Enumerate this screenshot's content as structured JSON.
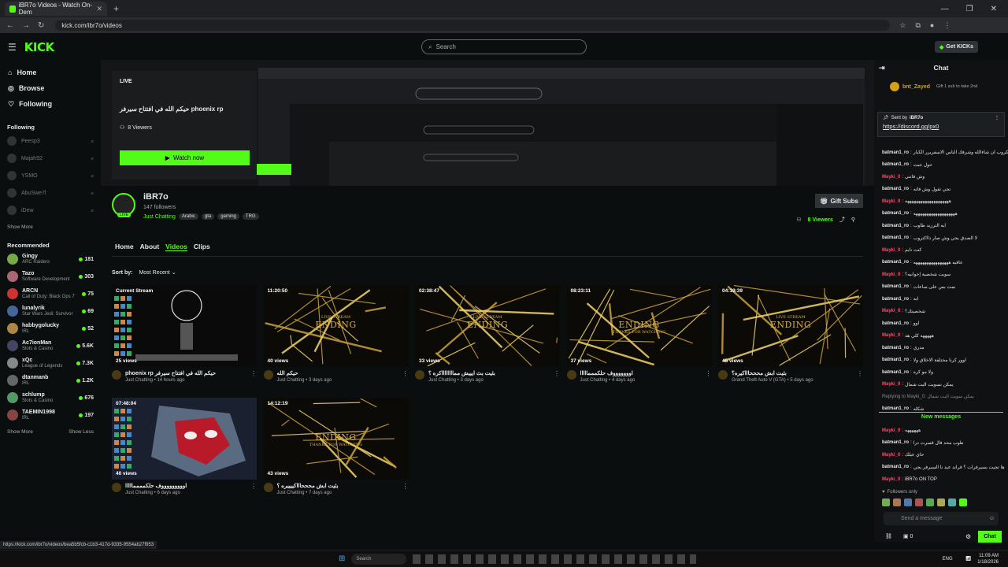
{
  "browser": {
    "tab_title": "iBR7o Videos - Watch On-Dem",
    "url": "kick.com/ibr7o/videos",
    "status_url": "https://kick.com/ibr7o/videos/bea5b5fcb-c1b3-417d-9335-9554ab27f953"
  },
  "header": {
    "logo": "KICK",
    "search_placeholder": "Search",
    "get_kicks": "Get KICKs"
  },
  "sidebar": {
    "nav": [
      {
        "label": "Home",
        "icon": "home-icon"
      },
      {
        "label": "Browse",
        "icon": "compass-icon"
      },
      {
        "label": "Following",
        "icon": "heart-icon"
      }
    ],
    "following_title": "Following",
    "following": [
      "Peesp3",
      "Majah92",
      "YSMO",
      "AbuSwe7l",
      "iDew"
    ],
    "show_more": "Show More",
    "show_less": "Show Less",
    "recommended_title": "Recommended",
    "recommended": [
      {
        "name": "Gingy",
        "cat": "ARC Raiders",
        "viewers": "181"
      },
      {
        "name": "Tazo",
        "cat": "Software Development",
        "viewers": "303"
      },
      {
        "name": "ARCN",
        "cat": "Call of Duty: Black Ops 7",
        "viewers": "75"
      },
      {
        "name": "lunalyrik",
        "cat": "Star Wars Jedi: Survivor",
        "viewers": "69"
      },
      {
        "name": "habbygolucky",
        "cat": "IRL",
        "viewers": "52"
      },
      {
        "name": "Ac7ionMan",
        "cat": "Slots & Casino",
        "viewers": "5.6K"
      },
      {
        "name": "xQc",
        "cat": "League of Legends",
        "viewers": "7.3K"
      },
      {
        "name": "dtanmanb",
        "cat": "IRL",
        "viewers": "1.2K"
      },
      {
        "name": "schlump",
        "cat": "Slots & Casino",
        "viewers": "676"
      },
      {
        "name": "TAEMIN1998",
        "cat": "IRL",
        "viewers": "197"
      }
    ]
  },
  "livecard": {
    "badge": "LIVE",
    "title": "phoenix rp حيكم الله في افتتاح سيرفر",
    "viewers": "8 Viewers",
    "watch": "Watch now"
  },
  "channel": {
    "name": "iBR7o",
    "followers": "147 followers",
    "category": "Just Chatting",
    "tags": [
      "Arabic",
      "gta",
      "gaming",
      "TRG"
    ],
    "gift_subs": "Gift Subs",
    "viewers": "8 Viewers",
    "live_badge": "LIVE"
  },
  "tabs": [
    "Home",
    "About",
    "Videos",
    "Clips"
  ],
  "sort": {
    "label": "Sort by:",
    "value": "Most Recent"
  },
  "videos": [
    {
      "dur": "Current Stream",
      "views": "25 views",
      "title": "phoenix rp حيكم الله في افتتاح سيرفر",
      "sub": "Just Chatting • 14 hours ago",
      "thumb": "stream"
    },
    {
      "dur": "11:20:50",
      "views": "40 views",
      "title": "حيكم الله",
      "sub": "Just Chatting • 3 days ago",
      "thumb": "ending"
    },
    {
      "dur": "02:38:47",
      "views": "33 views",
      "title": "بثيت بث ايييش ممااااااااكره ؟",
      "sub": "Just Chatting • 3 days ago",
      "thumb": "ending"
    },
    {
      "dur": "08:23:11",
      "views": "37 views",
      "title": "اوووووووف حلكمممااااا",
      "sub": "Just Chatting • 4 days ago",
      "thumb": "ending2"
    },
    {
      "dur": "04:19:39",
      "views": "45 views",
      "title": "بثيت ابش محححاااكيره؟",
      "sub": "Grand Theft Auto V (GTA) • 5 days ago",
      "thumb": "ending"
    },
    {
      "dur": "07:48:04",
      "views": "40 views",
      "title": "اوووووووووف حلكممممااااا",
      "sub": "Just Chatting • 6 days ago",
      "thumb": "spider"
    },
    {
      "dur": "14:12:19",
      "views": "43 views",
      "title": "بثيت ابش محححاااكييييره ؟",
      "sub": "Just Chatting • 7 days ago",
      "thumb": "ending2"
    }
  ],
  "ending": {
    "main": "ENDING",
    "live": "LIVE STREAM",
    "thanks": "THANKS FOR WATCHING"
  },
  "chat": {
    "title": "Chat",
    "top_gifter": "bnt_Zayed",
    "gift_text": "Gift 1 sub to take 2nd",
    "pinned_by": "Sent by",
    "pinned_user": "iBR7o",
    "pinned_link": "https://discord.gg/px0",
    "messages": [
      {
        "u": "batman1_ro",
        "t": "الكروب ان شاءالله وشرفك الناس الاسفريرر الكبار",
        "c": "u1"
      },
      {
        "u": "batman1_ro",
        "t": "حول جبت",
        "c": "u1"
      },
      {
        "u": "Mayki_0",
        "t": "وش فاتني",
        "c": "u2"
      },
      {
        "u": "batman1_ro",
        "t": "تجي تقول وش فاته",
        "c": "u1"
      },
      {
        "u": "Mayki_0",
        "t": "ههههههههههههههههههههه",
        "c": "u2"
      },
      {
        "u": "batman1_ro",
        "t": "هههههههههههههههههههه",
        "c": "u1"
      },
      {
        "u": "batman1_ro",
        "t": "ايه الترزيد طاوب",
        "c": "u1"
      },
      {
        "u": "batman1_ro",
        "t": "لا الصدق يجي وش صار ذااكتروب",
        "c": "u1"
      },
      {
        "u": "Mayki_0",
        "t": "كنت نايم",
        "c": "u2"
      },
      {
        "u": "batman1_ro",
        "t": "عافيه ههههههههههههههههه",
        "c": "u1"
      },
      {
        "u": "Mayki_0",
        "t": "سويت شخصية إخوانيه؟",
        "c": "u2"
      },
      {
        "u": "batman1_ro",
        "t": "نمت بس على ساعات",
        "c": "u1"
      },
      {
        "u": "batman1_ro",
        "t": "ايه",
        "c": "u1"
      },
      {
        "u": "Mayki_0",
        "t": "شخصيتك؟",
        "c": "u2"
      },
      {
        "u": "batman1_ro",
        "t": "اوو",
        "c": "u1"
      },
      {
        "u": "Mayki_0",
        "t": "هههههه كلي هذ",
        "c": "u2"
      },
      {
        "u": "batman1_ro",
        "t": "مدري",
        "c": "u1"
      },
      {
        "u": "batman1_ro",
        "t": "اوور كرنا مختلفة الاخلاق ولا",
        "c": "u1"
      },
      {
        "u": "batman1_ro",
        "t": "ولا مو كره",
        "c": "u1"
      },
      {
        "u": "Mayki_0",
        "t": "يمكن نسويت اليت شمال",
        "c": "u2"
      },
      {
        "u": "reply",
        "t": "Replying to Mayki_0: يمكن سويت اليت شمال",
        "c": "rp"
      },
      {
        "u": "batman1_ro",
        "t": "شكله",
        "c": "u1"
      }
    ],
    "new_messages": "New messages",
    "new": [
      {
        "u": "Mayki_0",
        "t": "ههههههه",
        "c": "u2"
      },
      {
        "u": "batman1_ro",
        "t": "طوب محد قال قسرت درا",
        "c": "u1"
      },
      {
        "u": "Mayki_0",
        "t": "حاي عيلك",
        "c": "u2"
      },
      {
        "u": "batman1_ro",
        "t": "ها تجيت بسيرفرات ؟ قراند عيد نا السيرفر يجي",
        "c": "u1"
      },
      {
        "u": "Mayki_0",
        "t": "iBR7o ON TOP",
        "c": "u2"
      }
    ],
    "followers_only": "Followers only",
    "send_placeholder": "Send a message",
    "chat_btn": "Chat",
    "points": "0"
  },
  "taskbar": {
    "lang": "ENG",
    "time": "11:09 AM",
    "date": "1/18/2026",
    "search": "Search"
  }
}
